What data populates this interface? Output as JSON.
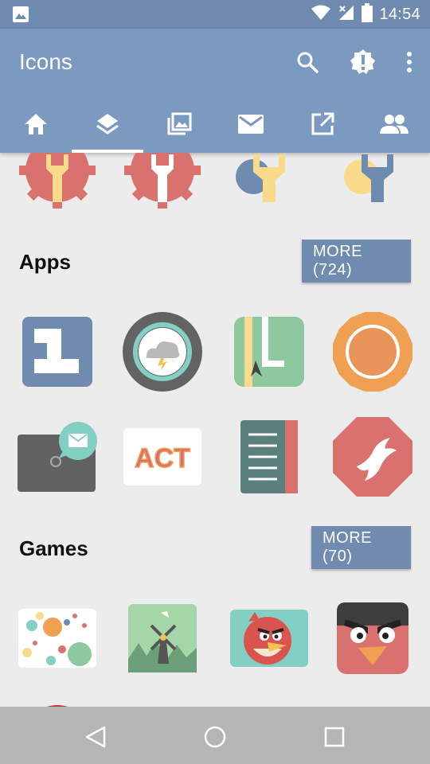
{
  "status_bar": {
    "time": "14:54",
    "icons": [
      "image-icon",
      "wifi-icon",
      "signal-icon",
      "battery-icon"
    ]
  },
  "app_bar": {
    "title": "Icons",
    "actions": [
      "search-icon",
      "alert-badge-icon",
      "more-vert-icon"
    ],
    "tabs": [
      {
        "icon": "home-icon",
        "active": false
      },
      {
        "icon": "layers-icon",
        "active": true
      },
      {
        "icon": "photos-icon",
        "active": false
      },
      {
        "icon": "mail-icon",
        "active": false
      },
      {
        "icon": "open-in-new-icon",
        "active": false
      },
      {
        "icon": "people-icon",
        "active": false
      }
    ]
  },
  "sections": {
    "apps": {
      "title": "Apps",
      "more_label": "MORE (724)"
    },
    "games": {
      "title": "Games",
      "more_label": "MORE (70)"
    }
  },
  "icons_text": {
    "act_label": "ACT"
  },
  "colors": {
    "primary": "#7c99bf",
    "primary_dark": "#6f8bb0",
    "background": "#ececec"
  },
  "nav_bar": {
    "buttons": [
      "back-icon",
      "home-circle-icon",
      "recents-icon"
    ]
  }
}
